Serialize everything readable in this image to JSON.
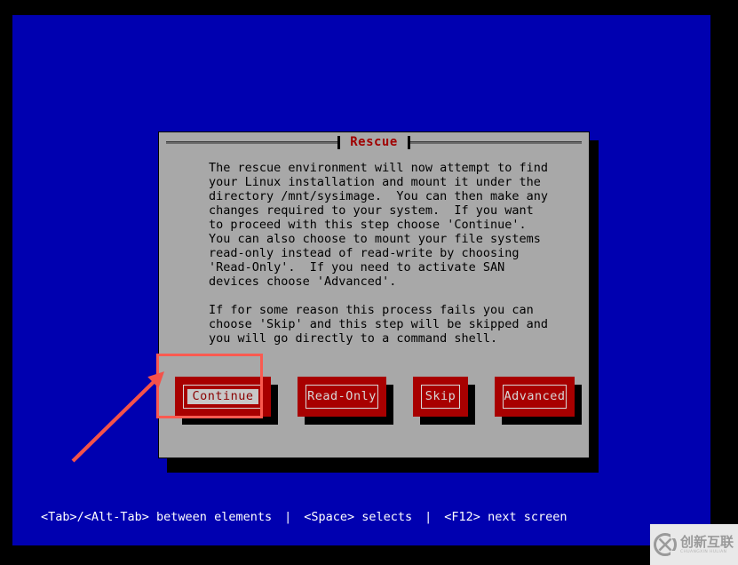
{
  "screen": {
    "background_color": "#0000b0",
    "letterbox_color": "#000000"
  },
  "dialog": {
    "title": "Rescue",
    "title_color": "#a00000",
    "body_color": "#a8a8a8",
    "body_text": "The rescue environment will now attempt to find\nyour Linux installation and mount it under the\ndirectory /mnt/sysimage.  You can then make any\nchanges required to your system.  If you want\nto proceed with this step choose 'Continue'.\nYou can also choose to mount your file systems\nread-only instead of read-write by choosing\n'Read-Only'.  If you need to activate SAN\ndevices choose 'Advanced'.\n\nIf for some reason this process fails you can\nchoose 'Skip' and this step will be skipped and\nyou will go directly to a command shell.",
    "buttons": [
      {
        "label": "Continue",
        "selected": true,
        "name": "continue"
      },
      {
        "label": "Read-Only",
        "selected": false,
        "name": "readonly"
      },
      {
        "label": "Skip",
        "selected": false,
        "name": "skip"
      },
      {
        "label": "Advanced",
        "selected": false,
        "name": "advanced"
      }
    ],
    "button_color": "#a80000",
    "button_text_color": "#d8d8d8"
  },
  "annotations": {
    "highlight_color": "#fa5a50",
    "arrow_color": "#f4524a",
    "highlight_target": "Continue",
    "arrow_points_to": "Continue"
  },
  "help_bar": {
    "items": [
      "<Tab>/<Alt-Tab> between elements",
      "<Space> selects",
      "<F12> next screen"
    ],
    "separator": "|",
    "text_color": "#ffffff"
  },
  "watermark": {
    "title": "创新互联",
    "subtitle": "CHUANGXIN HULIAN",
    "mark": "circle-x-logo"
  }
}
